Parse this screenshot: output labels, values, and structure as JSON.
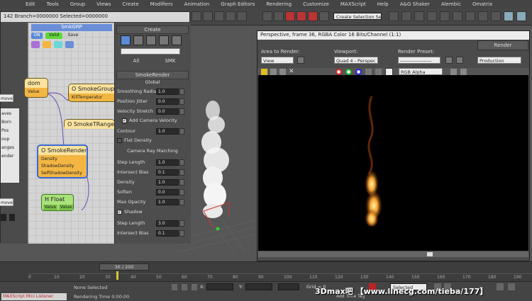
{
  "menu": [
    "Edit",
    "Tools",
    "Group",
    "Views",
    "Create",
    "Modifiers",
    "Animation",
    "Graph Editors",
    "Rendering",
    "Customize",
    "MAXScript",
    "Help",
    "A&G Shaker",
    "Alembic",
    "Omatrix"
  ],
  "toolbar": {
    "selection_set_placeholder": "Create Selection Se"
  },
  "node_window": {
    "title": "142  Branch=0000000  Selected=0000000",
    "left_items": [
      "move",
      "aves",
      "Born",
      "Pos",
      "oup",
      "anges",
      "ender",
      "move"
    ],
    "graph_title": "SmkGRP",
    "graph_buttons": [
      "ON",
      "Valid",
      "Save"
    ],
    "nodes": {
      "random": {
        "title": "dom",
        "param": "Value"
      },
      "smokegroup": {
        "title": "O SmokeGroup",
        "params": [
          "KillTemperatur"
        ]
      },
      "smoketrange": {
        "title": "O SmokeTRange"
      },
      "smokerender": {
        "title": "O SmokeRender",
        "params": [
          "Density",
          "ShadowDensity",
          "SelfShadowDensity"
        ]
      },
      "hfloat": {
        "title": "H Float",
        "ports": [
          "Value",
          "Value"
        ]
      }
    }
  },
  "command_panel": {
    "header": "Create",
    "tabs": [
      "All",
      "SMK"
    ],
    "rollout": "SmokeRender",
    "group_global": "Global",
    "params_top": [
      {
        "label": "Smoothing Radius",
        "value": "1.0"
      },
      {
        "label": "Position Jitter",
        "value": "0.0"
      },
      {
        "label": "Velocity Stretch",
        "value": "0.0"
      }
    ],
    "add_camera_velocity": "Add Camera Velocity",
    "contour": {
      "label": "Contour",
      "value": "1.0"
    },
    "flat_density": "Flat Density",
    "camera_ray_marching": "Camera Ray Marching",
    "params_march": [
      {
        "label": "Step Length",
        "value": "1.0"
      },
      {
        "label": "Intersect Bias",
        "value": "0.1"
      },
      {
        "label": "Density",
        "value": "1.0"
      },
      {
        "label": "Soften",
        "value": "0.0"
      },
      {
        "label": "Max Opacity",
        "value": "1.0"
      }
    ],
    "shadow": "Shadow",
    "params_shadow": [
      {
        "label": "Step Length",
        "value": "3.0"
      },
      {
        "label": "Intersect Bias",
        "value": "0.1"
      }
    ]
  },
  "render_window": {
    "title": "Perspective, frame 36, RGBA Color 16 Bits/Channel (1:1)",
    "area_label": "Area to Render:",
    "area_value": "View",
    "viewport_label": "Viewport:",
    "viewport_value": "Quad 4 - Perspec",
    "preset_label": "Render Preset:",
    "preset_value": "-------------------",
    "render_button": "Render",
    "production_value": "Production",
    "channel_value": "RGB Alpha"
  },
  "timeline": {
    "frame": "36 / 200",
    "ticks": [
      "0",
      "10",
      "20",
      "30",
      "40",
      "50",
      "60",
      "70",
      "80",
      "90",
      "100",
      "110",
      "120",
      "130",
      "140",
      "150",
      "160",
      "170",
      "180",
      "190"
    ]
  },
  "status": {
    "maxscript": "MAXScript Mini Listener",
    "none_selected": "None Selected",
    "rendering_time": "Rendering Time  0:00:00",
    "x_label": "X:",
    "y_label": "Y:",
    "grid_label": "Grid = 0",
    "add_time_tag": "Add Time Tag",
    "selected_value": "Selected",
    "watermark": "3Dmax吧  【www.linecg.com/tieba/177】"
  },
  "colors": {
    "accent_orange": "#f3b643",
    "node_green": "#a9e17b",
    "flame": "#f0a030"
  }
}
